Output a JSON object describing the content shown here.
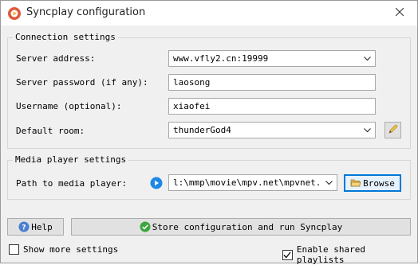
{
  "window": {
    "title": "Syncplay configuration"
  },
  "connection": {
    "group_title": "Connection settings",
    "server_address_label": "Server address:",
    "server_address_value": "www.vfly2.cn:19999",
    "server_password_label": "Server password (if any):",
    "server_password_value": "laosong",
    "username_label": "Username (optional):",
    "username_value": "xiaofei",
    "default_room_label": "Default room:",
    "default_room_value": "thunderGod4"
  },
  "media": {
    "group_title": "Media player settings",
    "path_label": "Path to media player:",
    "path_value": "l:\\mmp\\movie\\mpv.net\\mpvnet.exe",
    "browse_label": "Browse"
  },
  "actions": {
    "help_label": "Help",
    "store_label": "Store configuration and run Syncplay"
  },
  "options": {
    "show_more_label": "Show more settings",
    "show_more_checked": false,
    "shared_playlists_label": "Enable shared playlists",
    "shared_playlists_checked": true
  },
  "icons": {
    "app": "syncplay-logo-icon",
    "close": "close-icon",
    "edit": "pencil-icon",
    "player": "mpv-player-icon",
    "browse": "folder-open-icon",
    "help": "help-icon",
    "store": "checkmark-icon"
  },
  "colors": {
    "accent": "#0078d7",
    "check_green": "#3aa53a",
    "logo_red": "#e05a3b"
  }
}
